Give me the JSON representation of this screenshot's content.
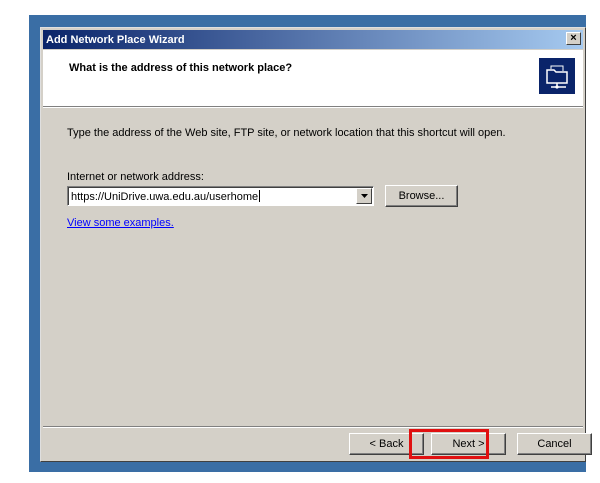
{
  "window": {
    "title": "Add Network Place Wizard",
    "close_glyph": "×"
  },
  "header": {
    "title": "What is the address of this network place?",
    "icon": "network-folder-icon"
  },
  "body": {
    "instruction": "Type the address of the Web site, FTP site, or network location that this shortcut will open.",
    "field_label": "Internet or network address:",
    "address_value": "https://UniDrive.uwa.edu.au/userhome",
    "browse_label": "Browse...",
    "examples_link": "View some examples."
  },
  "footer": {
    "back_label": "< Back",
    "next_label": "Next >",
    "cancel_label": "Cancel"
  },
  "colors": {
    "titlebar_start": "#0a246a",
    "titlebar_end": "#a6caf0",
    "highlight": "#e01010",
    "desktop": "#3a6ea5"
  }
}
